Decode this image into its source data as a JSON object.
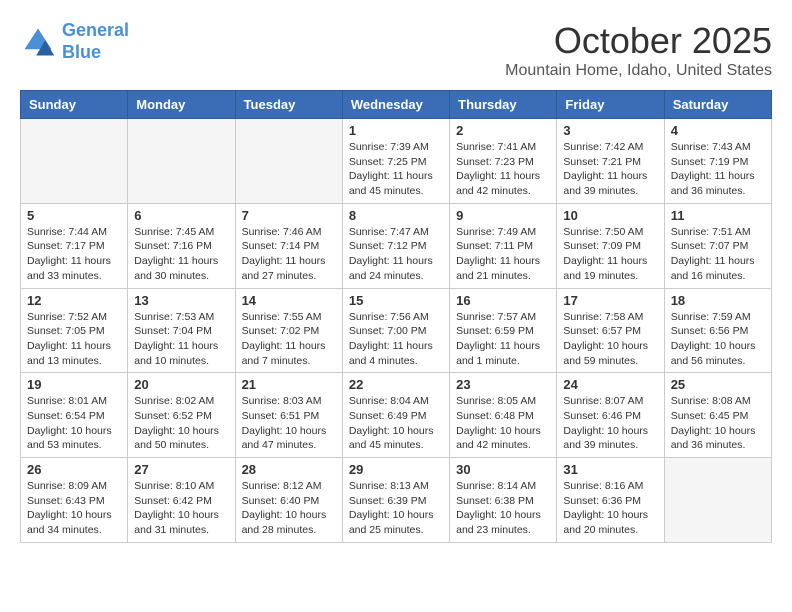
{
  "logo": {
    "line1": "General",
    "line2": "Blue"
  },
  "title": "October 2025",
  "location": "Mountain Home, Idaho, United States",
  "days_of_week": [
    "Sunday",
    "Monday",
    "Tuesday",
    "Wednesday",
    "Thursday",
    "Friday",
    "Saturday"
  ],
  "weeks": [
    [
      {
        "day": "",
        "info": ""
      },
      {
        "day": "",
        "info": ""
      },
      {
        "day": "",
        "info": ""
      },
      {
        "day": "1",
        "info": "Sunrise: 7:39 AM\nSunset: 7:25 PM\nDaylight: 11 hours and 45 minutes."
      },
      {
        "day": "2",
        "info": "Sunrise: 7:41 AM\nSunset: 7:23 PM\nDaylight: 11 hours and 42 minutes."
      },
      {
        "day": "3",
        "info": "Sunrise: 7:42 AM\nSunset: 7:21 PM\nDaylight: 11 hours and 39 minutes."
      },
      {
        "day": "4",
        "info": "Sunrise: 7:43 AM\nSunset: 7:19 PM\nDaylight: 11 hours and 36 minutes."
      }
    ],
    [
      {
        "day": "5",
        "info": "Sunrise: 7:44 AM\nSunset: 7:17 PM\nDaylight: 11 hours and 33 minutes."
      },
      {
        "day": "6",
        "info": "Sunrise: 7:45 AM\nSunset: 7:16 PM\nDaylight: 11 hours and 30 minutes."
      },
      {
        "day": "7",
        "info": "Sunrise: 7:46 AM\nSunset: 7:14 PM\nDaylight: 11 hours and 27 minutes."
      },
      {
        "day": "8",
        "info": "Sunrise: 7:47 AM\nSunset: 7:12 PM\nDaylight: 11 hours and 24 minutes."
      },
      {
        "day": "9",
        "info": "Sunrise: 7:49 AM\nSunset: 7:11 PM\nDaylight: 11 hours and 21 minutes."
      },
      {
        "day": "10",
        "info": "Sunrise: 7:50 AM\nSunset: 7:09 PM\nDaylight: 11 hours and 19 minutes."
      },
      {
        "day": "11",
        "info": "Sunrise: 7:51 AM\nSunset: 7:07 PM\nDaylight: 11 hours and 16 minutes."
      }
    ],
    [
      {
        "day": "12",
        "info": "Sunrise: 7:52 AM\nSunset: 7:05 PM\nDaylight: 11 hours and 13 minutes."
      },
      {
        "day": "13",
        "info": "Sunrise: 7:53 AM\nSunset: 7:04 PM\nDaylight: 11 hours and 10 minutes."
      },
      {
        "day": "14",
        "info": "Sunrise: 7:55 AM\nSunset: 7:02 PM\nDaylight: 11 hours and 7 minutes."
      },
      {
        "day": "15",
        "info": "Sunrise: 7:56 AM\nSunset: 7:00 PM\nDaylight: 11 hours and 4 minutes."
      },
      {
        "day": "16",
        "info": "Sunrise: 7:57 AM\nSunset: 6:59 PM\nDaylight: 11 hours and 1 minute."
      },
      {
        "day": "17",
        "info": "Sunrise: 7:58 AM\nSunset: 6:57 PM\nDaylight: 10 hours and 59 minutes."
      },
      {
        "day": "18",
        "info": "Sunrise: 7:59 AM\nSunset: 6:56 PM\nDaylight: 10 hours and 56 minutes."
      }
    ],
    [
      {
        "day": "19",
        "info": "Sunrise: 8:01 AM\nSunset: 6:54 PM\nDaylight: 10 hours and 53 minutes."
      },
      {
        "day": "20",
        "info": "Sunrise: 8:02 AM\nSunset: 6:52 PM\nDaylight: 10 hours and 50 minutes."
      },
      {
        "day": "21",
        "info": "Sunrise: 8:03 AM\nSunset: 6:51 PM\nDaylight: 10 hours and 47 minutes."
      },
      {
        "day": "22",
        "info": "Sunrise: 8:04 AM\nSunset: 6:49 PM\nDaylight: 10 hours and 45 minutes."
      },
      {
        "day": "23",
        "info": "Sunrise: 8:05 AM\nSunset: 6:48 PM\nDaylight: 10 hours and 42 minutes."
      },
      {
        "day": "24",
        "info": "Sunrise: 8:07 AM\nSunset: 6:46 PM\nDaylight: 10 hours and 39 minutes."
      },
      {
        "day": "25",
        "info": "Sunrise: 8:08 AM\nSunset: 6:45 PM\nDaylight: 10 hours and 36 minutes."
      }
    ],
    [
      {
        "day": "26",
        "info": "Sunrise: 8:09 AM\nSunset: 6:43 PM\nDaylight: 10 hours and 34 minutes."
      },
      {
        "day": "27",
        "info": "Sunrise: 8:10 AM\nSunset: 6:42 PM\nDaylight: 10 hours and 31 minutes."
      },
      {
        "day": "28",
        "info": "Sunrise: 8:12 AM\nSunset: 6:40 PM\nDaylight: 10 hours and 28 minutes."
      },
      {
        "day": "29",
        "info": "Sunrise: 8:13 AM\nSunset: 6:39 PM\nDaylight: 10 hours and 25 minutes."
      },
      {
        "day": "30",
        "info": "Sunrise: 8:14 AM\nSunset: 6:38 PM\nDaylight: 10 hours and 23 minutes."
      },
      {
        "day": "31",
        "info": "Sunrise: 8:16 AM\nSunset: 6:36 PM\nDaylight: 10 hours and 20 minutes."
      },
      {
        "day": "",
        "info": ""
      }
    ]
  ]
}
